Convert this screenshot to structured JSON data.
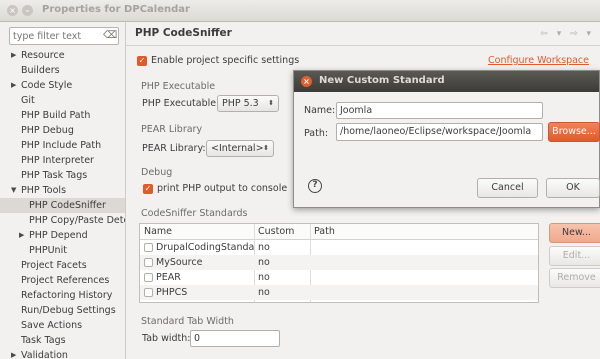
{
  "window": {
    "title": "Properties for DPCalendar",
    "close_glyph": "×",
    "min_glyph": "–"
  },
  "filter": {
    "placeholder": "type filter text",
    "clear_glyph": "⌫"
  },
  "tree": {
    "expanded_glyph": "▼",
    "collapsed_glyph": "▶",
    "items": [
      {
        "label": "Resource",
        "arrow": "collapsed"
      },
      {
        "label": "Builders"
      },
      {
        "label": "Code Style",
        "arrow": "collapsed"
      },
      {
        "label": "Git"
      },
      {
        "label": "PHP Build Path"
      },
      {
        "label": "PHP Debug"
      },
      {
        "label": "PHP Include Path"
      },
      {
        "label": "PHP Interpreter"
      },
      {
        "label": "PHP Task Tags"
      },
      {
        "label": "PHP Tools",
        "arrow": "expanded"
      },
      {
        "label": "PHP CodeSniffer",
        "selected": true
      },
      {
        "label": "PHP Copy/Paste Detector"
      },
      {
        "label": "PHP Depend",
        "arrow": "collapsed"
      },
      {
        "label": "PHPUnit"
      },
      {
        "label": "Project Facets"
      },
      {
        "label": "Project References"
      },
      {
        "label": "Refactoring History"
      },
      {
        "label": "Run/Debug Settings"
      },
      {
        "label": "Save Actions"
      },
      {
        "label": "Task Tags"
      },
      {
        "label": "Validation",
        "arrow": "collapsed"
      }
    ]
  },
  "page": {
    "title": "PHP CodeSniffer",
    "nav_glyphs": "⇦ ▾ ⇨ ▾",
    "check_glyph": "✓",
    "enable_label": "Enable project specific settings",
    "configure_link": "Configure Workspace",
    "php_exec_section": "PHP Executable",
    "php_exec_label": "PHP Executable:",
    "php_exec_value": "PHP 5.3",
    "pear_section": "PEAR Library",
    "pear_label": "PEAR Library:",
    "pear_value": "<Internal>",
    "combo_arrow": "⬍",
    "debug_section": "Debug",
    "debug_label": "print PHP output to console",
    "standards_section": "CodeSniffer Standards",
    "table_headers": {
      "name": "Name",
      "custom": "Custom",
      "path": "Path"
    },
    "rows": [
      {
        "name": "DrupalCodingStandard",
        "custom": "no"
      },
      {
        "name": "MySource",
        "custom": "no"
      },
      {
        "name": "PEAR",
        "custom": "no"
      },
      {
        "name": "PHPCS",
        "custom": "no"
      }
    ],
    "btn_new": "New...",
    "btn_edit": "Edit...",
    "btn_remove": "Remove",
    "tab_section": "Standard Tab Width",
    "tab_label": "Tab width:",
    "tab_value": "0"
  },
  "dialog": {
    "title": "New Custom Standard",
    "close_glyph": "×",
    "name_label": "Name:",
    "name_value": "Joomla",
    "path_label": "Path:",
    "path_value": "/home/laoneo/Eclipse/workspace/Joomla",
    "browse_label": "Browse...",
    "help_glyph": "?",
    "cancel_label": "Cancel",
    "ok_label": "OK"
  }
}
